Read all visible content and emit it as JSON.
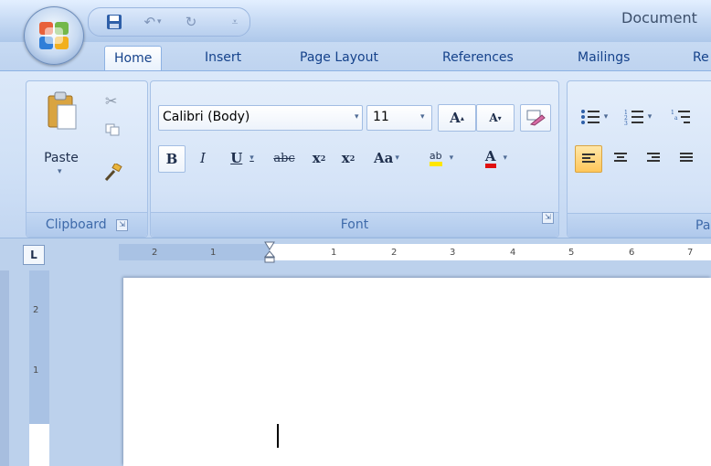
{
  "window": {
    "title": "Document"
  },
  "quick_access": {
    "icons": [
      "save-icon",
      "undo-icon",
      "redo-icon",
      "customize-icon"
    ]
  },
  "tabs": [
    {
      "label": "Home",
      "active": true
    },
    {
      "label": "Insert"
    },
    {
      "label": "Page Layout"
    },
    {
      "label": "References"
    },
    {
      "label": "Mailings"
    },
    {
      "label": "Re"
    }
  ],
  "clipboard": {
    "paste_label": "Paste",
    "group_label": "Clipboard"
  },
  "font": {
    "group_label": "Font",
    "font_name": "Calibri (Body)",
    "font_size": "11",
    "bold": "B",
    "italic": "I",
    "underline": "U",
    "strike": "abc",
    "subscript": "x",
    "superscript": "x",
    "change_case": "Aa",
    "grow": "A",
    "shrink": "A",
    "highlight": "ab",
    "font_color": "A"
  },
  "paragraph": {
    "group_label": "Para"
  },
  "ruler": {
    "corner": "L",
    "ticks": [
      "2",
      "1",
      "1",
      "2",
      "3",
      "4",
      "5",
      "6",
      "7"
    ]
  },
  "vertical_ruler": {
    "ticks": [
      "2",
      "1"
    ]
  },
  "colors": {
    "accent": "#15428b",
    "highlight": "#ffe600",
    "font_red": "#e01010"
  }
}
